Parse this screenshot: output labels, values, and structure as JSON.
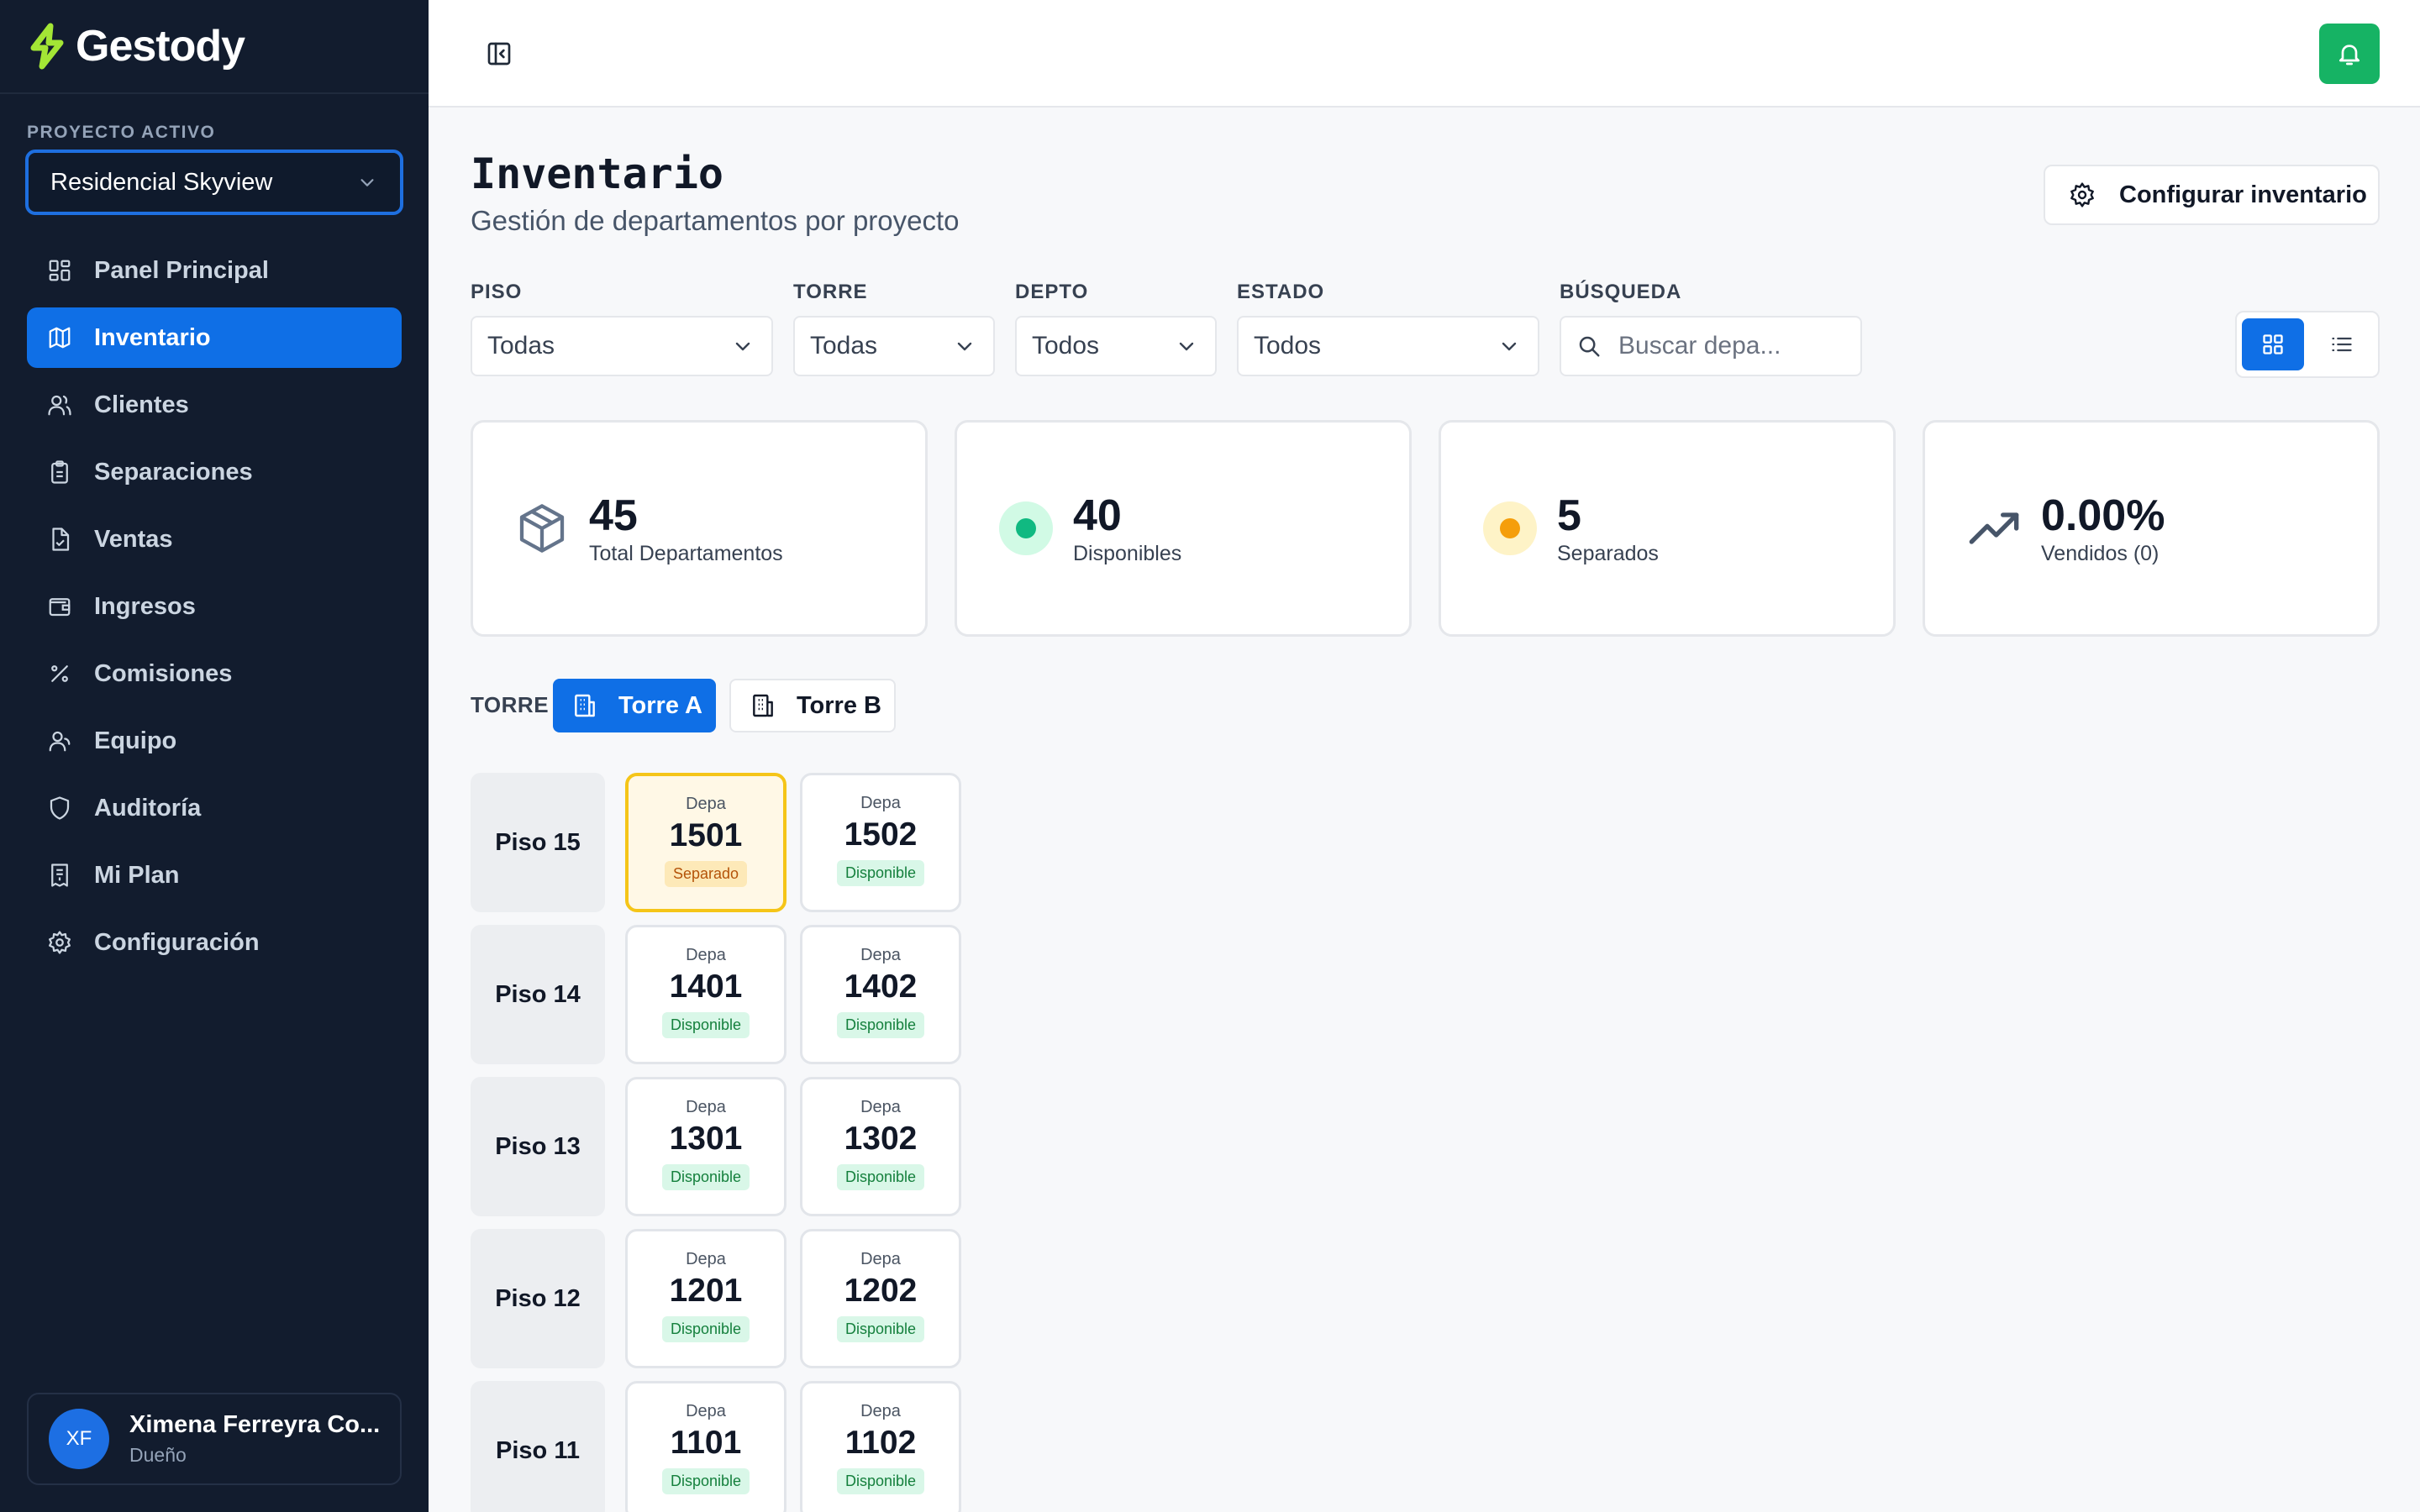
{
  "brand": {
    "name": "Gestody"
  },
  "project": {
    "label": "PROYECTO ACTIVO",
    "selected": "Residencial Skyview"
  },
  "nav": [
    {
      "label": "Panel Principal",
      "icon": "dashboard-icon"
    },
    {
      "label": "Inventario",
      "icon": "map-icon",
      "active": true
    },
    {
      "label": "Clientes",
      "icon": "users-icon"
    },
    {
      "label": "Separaciones",
      "icon": "clipboard-icon"
    },
    {
      "label": "Ventas",
      "icon": "file-check-icon"
    },
    {
      "label": "Ingresos",
      "icon": "wallet-icon"
    },
    {
      "label": "Comisiones",
      "icon": "percent-icon"
    },
    {
      "label": "Equipo",
      "icon": "user-icon"
    },
    {
      "label": "Auditoría",
      "icon": "shield-icon"
    },
    {
      "label": "Mi Plan",
      "icon": "receipt-icon"
    },
    {
      "label": "Configuración",
      "icon": "gear-icon"
    }
  ],
  "user": {
    "initials": "XF",
    "name": "Ximena Ferreyra Co...",
    "role": "Dueño"
  },
  "page": {
    "title": "Inventario",
    "subtitle": "Gestión de departamentos por proyecto",
    "config_button": "Configurar inventario"
  },
  "filters": {
    "piso": {
      "label": "PISO",
      "value": "Todas"
    },
    "torre": {
      "label": "TORRE",
      "value": "Todas"
    },
    "depto": {
      "label": "DEPTO",
      "value": "Todos"
    },
    "estado": {
      "label": "ESTADO",
      "value": "Todos"
    },
    "busqueda": {
      "label": "BÚSQUEDA",
      "placeholder": "Buscar depa..."
    }
  },
  "view_mode": "grid",
  "stats": {
    "total": {
      "value": "45",
      "label": "Total Departamentos"
    },
    "disponibles": {
      "value": "40",
      "label": "Disponibles"
    },
    "separados": {
      "value": "5",
      "label": "Separados"
    },
    "vendidos": {
      "value": "0.00%",
      "label": "Vendidos (0)"
    }
  },
  "torres": {
    "label": "TORRE",
    "a": "Torre A",
    "b": "Torre B",
    "selected": "Torre A"
  },
  "unit_prefix": "Depa",
  "floors": [
    {
      "label": "Piso 15",
      "units": [
        {
          "num": "1501",
          "status": "Separado"
        },
        {
          "num": "1502",
          "status": "Disponible"
        }
      ]
    },
    {
      "label": "Piso 14",
      "units": [
        {
          "num": "1401",
          "status": "Disponible"
        },
        {
          "num": "1402",
          "status": "Disponible"
        }
      ]
    },
    {
      "label": "Piso 13",
      "units": [
        {
          "num": "1301",
          "status": "Disponible"
        },
        {
          "num": "1302",
          "status": "Disponible"
        }
      ]
    },
    {
      "label": "Piso 12",
      "units": [
        {
          "num": "1201",
          "status": "Disponible"
        },
        {
          "num": "1202",
          "status": "Disponible"
        }
      ]
    },
    {
      "label": "Piso 11",
      "units": [
        {
          "num": "1101",
          "status": "Disponible"
        },
        {
          "num": "1102",
          "status": "Disponible"
        }
      ]
    }
  ],
  "colors": {
    "sidebar_bg": "#121c2e",
    "accent": "#0f6fe6",
    "brand_green": "#a3e635",
    "bell_green": "#16b364",
    "available": "#10b981",
    "separated": "#f59e0b"
  }
}
